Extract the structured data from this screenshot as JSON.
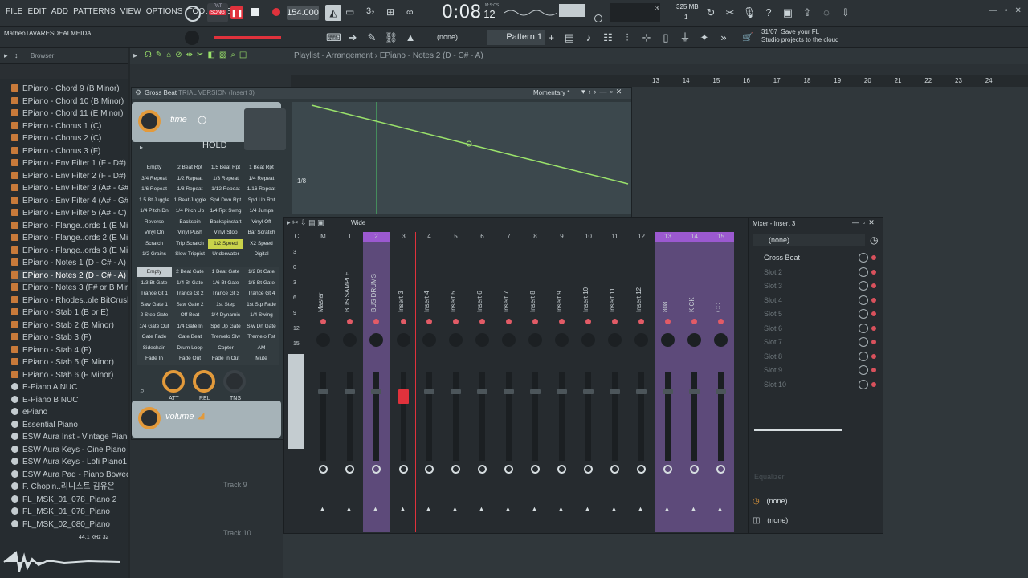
{
  "menu": [
    "FILE",
    "EDIT",
    "ADD",
    "PATTERNS",
    "VIEW",
    "OPTIONS",
    "TOOLS",
    "HELP"
  ],
  "transport": {
    "pat_label": "PAT",
    "song_label": "SONG",
    "tempo": "154.000",
    "time": "0:08",
    "time_sub": "12",
    "time_unit": "M:S:CS",
    "cpu_mem": "325 MB",
    "cpu_count": "3",
    "poly": "1"
  },
  "project_user": "MatheoTAVARESDEALMEIDA",
  "pattern": {
    "none_label": "(none)",
    "name": "Pattern 1"
  },
  "notice": {
    "date": "31/07",
    "text1": "Save your FL",
    "text2": "Studio projects to the cloud"
  },
  "browser": {
    "title": "Browser",
    "items": [
      "EPiano - Chord 9 (B Minor)",
      "EPiano - Chord 10 (B Minor)",
      "EPiano - Chord 11 (E Minor)",
      "EPiano - Chorus 1 (C)",
      "EPiano - Chorus 2 (C)",
      "EPiano - Chorus 3 (F)",
      "EPiano - Env Filter 1 (F - D#)",
      "EPiano - Env Filter 2 (F - D#)",
      "EPiano - Env Filter 3 (A# - G#)",
      "EPiano - Env Filter 4 (A# - G#)",
      "EPiano - Env Filter 5 (A# - C)",
      "EPiano - Flange..ords 1 (E Minor)",
      "EPiano - Flange..ords 2 (E Minor)",
      "EPiano - Flange..ords 3 (E Minor)",
      "EPiano - Notes 1 (D - C# - A)",
      "EPiano - Notes 2 (D - C# - A)",
      "EPiano - Notes 3 (F# or B Minor)",
      "EPiano - Rhodes..ole BitCrush (C)",
      "EPiano - Stab 1 (B or E)",
      "EPiano - Stab 2 (B Minor)",
      "EPiano - Stab 3 (F)",
      "EPiano - Stab 4 (F)",
      "EPiano - Stab 5 (E Minor)",
      "EPiano - Stab 6 (F Minor)",
      "E-Piano A NUC",
      "E-Piano B NUC",
      "ePiano",
      "Essential Piano",
      "ESW Aura Inst - Vintage Piano - C",
      "ESW Aura Keys - Cine Piano - C",
      "ESW Aura Keys - Lofi Piano1 - C",
      "ESW Aura Pad - Piano Bowed - C",
      "F. Chopin..리니스트 김유은",
      "FL_MSK_01_078_Piano 2",
      "FL_MSK_01_078_Piano",
      "FL_MSK_02_080_Piano"
    ],
    "selected_index": 15,
    "sample_rate": "44.1 kHz 32"
  },
  "playlist": {
    "title": "Playlist - Arrangement",
    "pattern": "EPiano - Notes 2 (D - C# - A)",
    "bars": [
      "13",
      "14",
      "15",
      "16",
      "17",
      "18",
      "19",
      "20",
      "21",
      "22",
      "23",
      "24"
    ],
    "track9": "Track 9",
    "track10": "Track 10"
  },
  "grossbeat": {
    "title": "Gross Beat",
    "subtitle": "TRIAL VERSION (Insert 3)",
    "preset": "Momentary *",
    "time_label": "time",
    "hold_label": "HOLD",
    "volume_label": "volume",
    "grid_label": "1/8",
    "time_buttons": [
      "Empty",
      "2 Beat Rpt",
      "1.5 Beat Rpt",
      "1 Beat Rpt",
      "3/4 Repeat",
      "1/2 Repeat",
      "1/3 Repeat",
      "1/4 Repeat",
      "1/6 Repeat",
      "1/8 Repeat",
      "1/12 Repeat",
      "1/16 Repeat",
      "1.5 Bt Juggle",
      "1 Beat Juggle",
      "Spd Dwn Rpt",
      "Spd Up Rpt",
      "1/4 Pitch Dn",
      "1/4 Pitch Up",
      "1/4 Rpt Swng",
      "1/4 Jumps",
      "Reverse",
      "Backspin",
      "Backspinstart",
      "Vinyl Off",
      "Vinyl On",
      "Vinyl Push",
      "Vinyl Stop",
      "Bar Scratch",
      "Scratch",
      "Trip Scratch",
      "1/2 Speed",
      "X2 Speed",
      "1/2 Grains",
      "Slow Trippist",
      "Underwater",
      "Digital"
    ],
    "vol_buttons": [
      "Empty",
      "2 Beat Gate",
      "1 Beat Gate",
      "1/2 Bt Gate",
      "1/3 Bt Gate",
      "1/4 Bt Gate",
      "1/6 Bt Gate",
      "1/8 Bt Gate",
      "Trance Gt 1",
      "Trance Gt 2",
      "Trance Gt 3",
      "Trance Gt 4",
      "Saw Gate 1",
      "Saw Gate 2",
      "1st Step",
      "1st Stp Fade",
      "2 Step Gate",
      "Off Beat",
      "1/4 Dynamic",
      "1/4 Swing",
      "1/4 Gate Out",
      "1/4 Gate In",
      "Spd Up Gate",
      "Slw Dn Gate",
      "Gate Fade",
      "Gate Beat",
      "Tremelo Slw",
      "Tremelo Fst",
      "Sidechain",
      "Drum Loop",
      "Copter",
      "AM",
      "Fade In",
      "Fade Out",
      "Fade In Out",
      "Mute"
    ],
    "knobs": [
      "ATT",
      "REL",
      "TNS"
    ]
  },
  "mixer": {
    "width_label": "Wide",
    "strips": [
      {
        "num": "C",
        "name": ""
      },
      {
        "num": "M",
        "name": "Master"
      },
      {
        "num": "1",
        "name": "BUS SAMPLE"
      },
      {
        "num": "2",
        "name": "BUS DRUMS"
      },
      {
        "num": "3",
        "name": "Insert 3"
      },
      {
        "num": "4",
        "name": "Insert 4"
      },
      {
        "num": "5",
        "name": "Insert 5"
      },
      {
        "num": "6",
        "name": "Insert 6"
      },
      {
        "num": "7",
        "name": "Insert 7"
      },
      {
        "num": "8",
        "name": "Insert 8"
      },
      {
        "num": "9",
        "name": "Insert 9"
      },
      {
        "num": "10",
        "name": "Insert 10"
      },
      {
        "num": "11",
        "name": "Insert 11"
      },
      {
        "num": "12",
        "name": "Insert 12"
      },
      {
        "num": "13",
        "name": "808"
      },
      {
        "num": "14",
        "name": "KICK"
      },
      {
        "num": "15",
        "name": "CC"
      }
    ],
    "scale": [
      "3",
      "0",
      "3",
      "6",
      "9",
      "12",
      "15"
    ]
  },
  "mixer_insert": {
    "title": "Mixer - Insert 3",
    "input": "(none)",
    "slots": [
      "Gross Beat",
      "Slot 2",
      "Slot 3",
      "Slot 4",
      "Slot 5",
      "Slot 6",
      "Slot 7",
      "Slot 8",
      "Slot 9",
      "Slot 10"
    ],
    "eq_label": "Equalizer",
    "out1": "(none)",
    "out2": "(none)"
  },
  "colors": {
    "accent": "#e39a3b",
    "green": "#9be36b",
    "purple": "#6a4a8a",
    "red": "#e0323c"
  }
}
